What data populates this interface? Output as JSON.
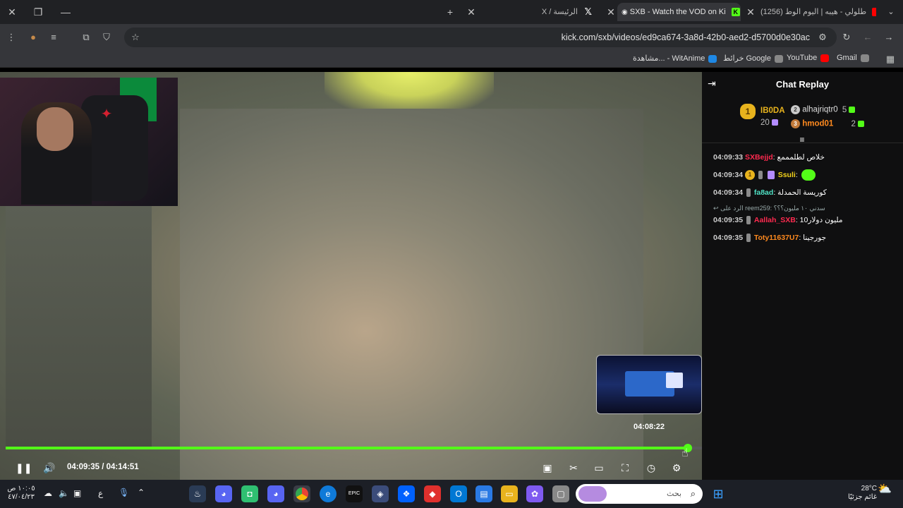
{
  "browser": {
    "tabs": [
      {
        "label": "(1256) طلولي - هيبه | اليوم الوط",
        "icon": "youtube-icon",
        "color": "#ff0000"
      },
      {
        "label": "SXB - Watch the VOD on Ki",
        "icon": "kick-icon",
        "color": "#53fc18"
      },
      {
        "label": "X / الرئيسة",
        "icon": "x-icon",
        "color": "#ffffff"
      }
    ],
    "url": "kick.com/sxb/videos/ed9ca674-3a8d-42b0-aed2-d5700d0e30ac",
    "bookmarks": [
      {
        "label": "Gmail",
        "icon": "globe-icon"
      },
      {
        "label": "YouTube",
        "icon": "youtube-icon"
      },
      {
        "label": "خرائط Google",
        "icon": "globe-icon"
      },
      {
        "label": "مشاهدة... - WitAnime",
        "icon": "witanime-icon"
      }
    ]
  },
  "player": {
    "current_time": "04:09:35",
    "duration": "04:14:51",
    "time_sep": " / ",
    "progress_fraction": 0.9799,
    "preview_time": "04:08:22"
  },
  "chat": {
    "title": "Chat Replay",
    "leaderboard": [
      {
        "name": "IB0DA",
        "count": "20",
        "rank": "1"
      },
      {
        "name": "alhajriqtr0",
        "count": "5",
        "rank": "2"
      },
      {
        "name": "hmod01",
        "count": "2",
        "rank": "3"
      }
    ],
    "messages": [
      {
        "time": "04:09:33",
        "user": "SXBejjd",
        "text": "خلاص لطلمممع",
        "color": "#ff2a4f",
        "reply": ""
      },
      {
        "time": "04:09:34",
        "user": "Ssuli",
        "text": "",
        "color": "#f2d21b",
        "reply": ""
      },
      {
        "time": "04:09:34",
        "user": "fa8ad",
        "text": "كوريسة الحمدلة",
        "color": "#4fe0c4",
        "reply": ""
      },
      {
        "time": "04:09:35",
        "user": "Aallah_SXB",
        "text": "مليون دولار10",
        "color": "#ff2a4f",
        "reply": "الرد على reem259: سدني ١٠ مليون؟؟؟"
      },
      {
        "time": "04:09:35",
        "user": "Toty11637U7",
        "text": "جورجينا",
        "color": "#ff8a1f",
        "reply": ""
      }
    ]
  },
  "taskbar": {
    "search_placeholder": "بحث",
    "weather_temp": "28°C",
    "weather_text": "غائم جزئيًا",
    "clock_time": "١٠:٠٥ ص",
    "clock_date": "٤٧/٠٤/٢٣",
    "lang": "ع"
  }
}
